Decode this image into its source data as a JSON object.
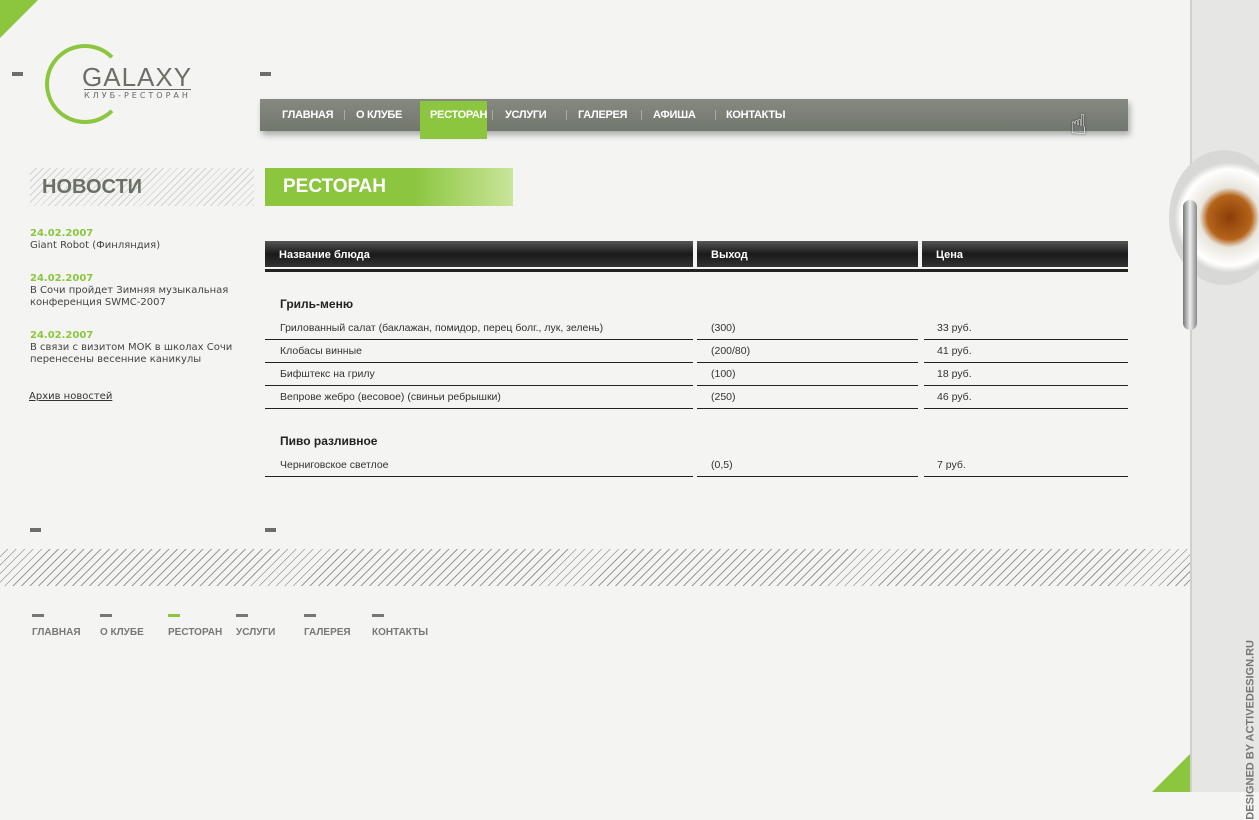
{
  "logo": {
    "title": "GALAXY",
    "subtitle": "КЛУБ-РЕСТОРАН"
  },
  "nav": {
    "items": [
      "ГЛАВНАЯ",
      "О КЛУБЕ",
      "РЕСТОРАН",
      "УСЛУГИ",
      "ГАЛЕРЕЯ",
      "АФИША",
      "КОНТАКТЫ"
    ],
    "active": "РЕСТОРАН"
  },
  "news": {
    "title": "НОВОСТИ",
    "items": [
      {
        "date": "24.02.2007",
        "text": "Giant Robot (Финляндия)"
      },
      {
        "date": "24.02.2007",
        "text": "В Сочи пройдет Зимняя музыкальная конференция SWMC-2007"
      },
      {
        "date": "24.02.2007",
        "text": "В связи с визитом МОК в школах Сочи перенесены весенние каникулы"
      }
    ],
    "archive": "Архив новостей"
  },
  "page": {
    "title": "РЕСТОРАН"
  },
  "menu": {
    "headers": [
      "Название блюда",
      "Выход",
      "Цена"
    ],
    "sections": [
      {
        "title": "Гриль-меню",
        "rows": [
          [
            "Грилованный салат (баклажан, помидор, перец болг., лук, зелень)",
            "(300)",
            "33 руб."
          ],
          [
            "Клобасы винные",
            "(200/80)",
            "41 руб."
          ],
          [
            "Бифштекс на грилу",
            "(100)",
            "18 руб."
          ],
          [
            "Вепрове жебро (весовое) (свиньи ребрышки)",
            "(250)",
            "46 руб."
          ]
        ]
      },
      {
        "title": "Пиво разливное",
        "rows": [
          [
            "Черниговское светлое",
            "(0,5)",
            "7 руб."
          ]
        ]
      }
    ]
  },
  "footer": {
    "nav": [
      "ГЛАВНАЯ",
      "О КЛУБЕ",
      "РЕСТОРАН",
      "УСЛУГИ",
      "ГАЛЕРЕЯ",
      "КОНТАКТЫ"
    ],
    "active": "РЕСТОРАН"
  },
  "credit": "DESIGNED BY ACTIVEDESIGN.RU",
  "colors": {
    "accent": "#8cc63f",
    "nav_bg": "#7a7e75"
  }
}
